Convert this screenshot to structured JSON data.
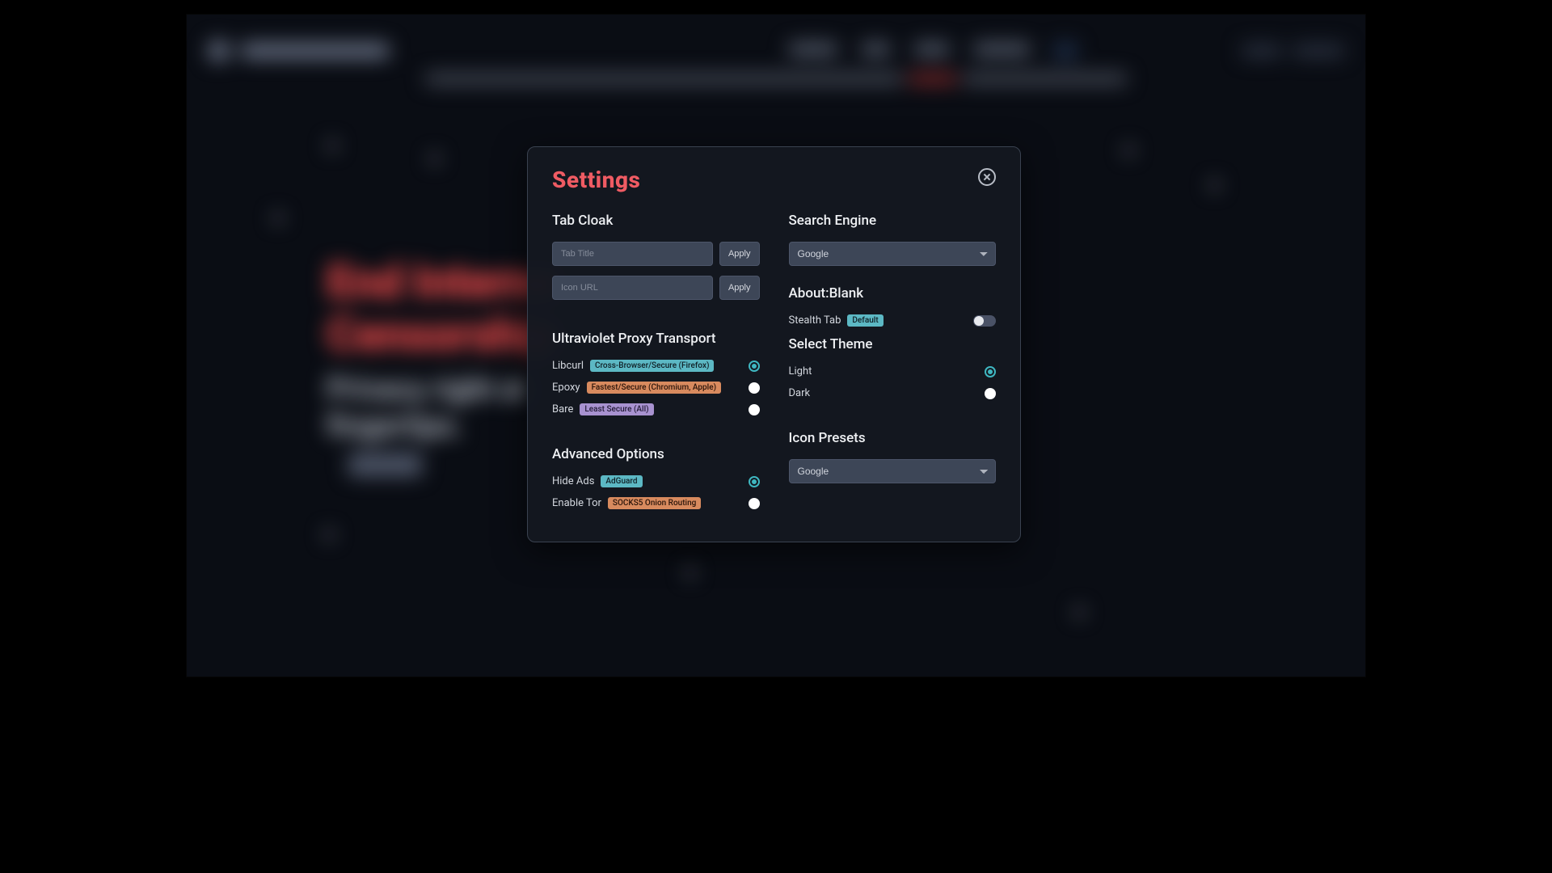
{
  "background": {
    "hero_line1": "End Interne",
    "hero_line2": "Censorship",
    "sub_line1": "Privacy right at",
    "sub_line2": "fingertips."
  },
  "modal": {
    "title": "Settings",
    "left": {
      "tab_cloak": {
        "heading": "Tab Cloak",
        "tab_title_placeholder": "Tab Title",
        "tab_title_value": "",
        "icon_url_placeholder": "Icon URL",
        "icon_url_value": "",
        "apply_btn": "Apply"
      },
      "proxy": {
        "heading": "Ultraviolet Proxy Transport",
        "options": [
          {
            "label": "Libcurl",
            "badge": "Cross-Browser/Secure (Firefox)",
            "badge_class": "badge-teal",
            "selected": true
          },
          {
            "label": "Epoxy",
            "badge": "Fastest/Secure (Chromium, Apple)",
            "badge_class": "badge-orange",
            "selected": false
          },
          {
            "label": "Bare",
            "badge": "Least Secure (All)",
            "badge_class": "badge-purple",
            "selected": false
          }
        ]
      },
      "advanced": {
        "heading": "Advanced Options",
        "options": [
          {
            "label": "Hide Ads",
            "badge": "AdGuard",
            "badge_class": "badge-teal",
            "selected": true
          },
          {
            "label": "Enable Tor",
            "badge": "SOCKS5 Onion Routing",
            "badge_class": "badge-orange",
            "selected": false
          }
        ]
      }
    },
    "right": {
      "search_engine": {
        "heading": "Search Engine",
        "selected": "Google"
      },
      "about_blank": {
        "heading": "About:Blank",
        "toggle_label": "Stealth Tab",
        "toggle_badge": "Default",
        "toggle_on": false
      },
      "theme": {
        "heading": "Select Theme",
        "options": [
          {
            "label": "Light",
            "selected": true
          },
          {
            "label": "Dark",
            "selected": false
          }
        ]
      },
      "icon_presets": {
        "heading": "Icon Presets",
        "selected": "Google"
      }
    }
  }
}
